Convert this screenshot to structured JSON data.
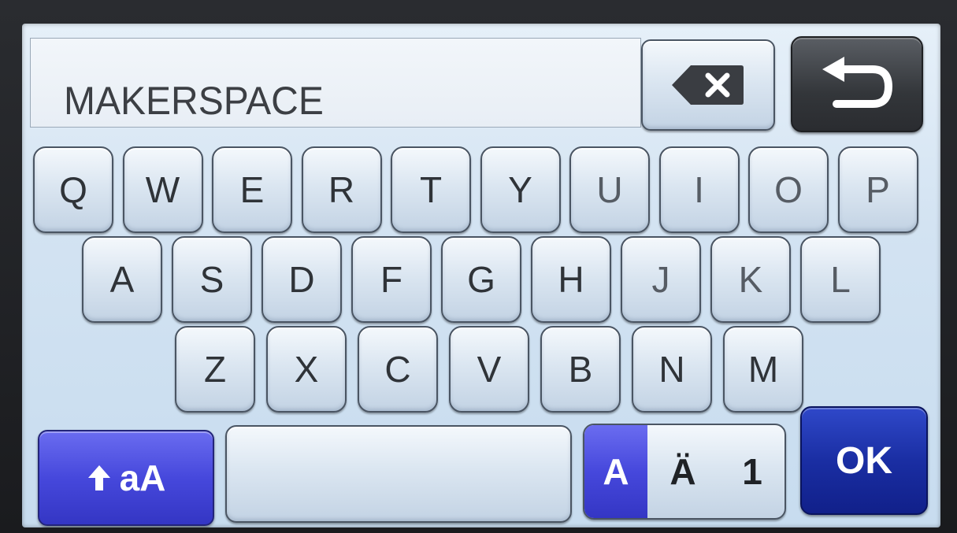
{
  "text_field": {
    "value": "MAKERSPACE"
  },
  "keyboard": {
    "row1": [
      "Q",
      "W",
      "E",
      "R",
      "T",
      "Y",
      "U",
      "I",
      "O",
      "P"
    ],
    "row2": [
      "A",
      "S",
      "D",
      "F",
      "G",
      "H",
      "J",
      "K",
      "L"
    ],
    "row3": [
      "Z",
      "X",
      "C",
      "V",
      "B",
      "N",
      "M"
    ]
  },
  "function_keys": {
    "backspace_icon": "backspace-icon",
    "back_icon": "return-arrow-icon",
    "shift_label": "aA",
    "shift_icon": "up-arrow-icon",
    "ok_label": "OK"
  },
  "mode_selector": {
    "modes": [
      "A",
      "Ä",
      "1"
    ],
    "selected": "A"
  },
  "colors": {
    "accent_blue": "#4648dc",
    "ok_blue": "#1a2ea3",
    "back_dark": "#33363a"
  }
}
